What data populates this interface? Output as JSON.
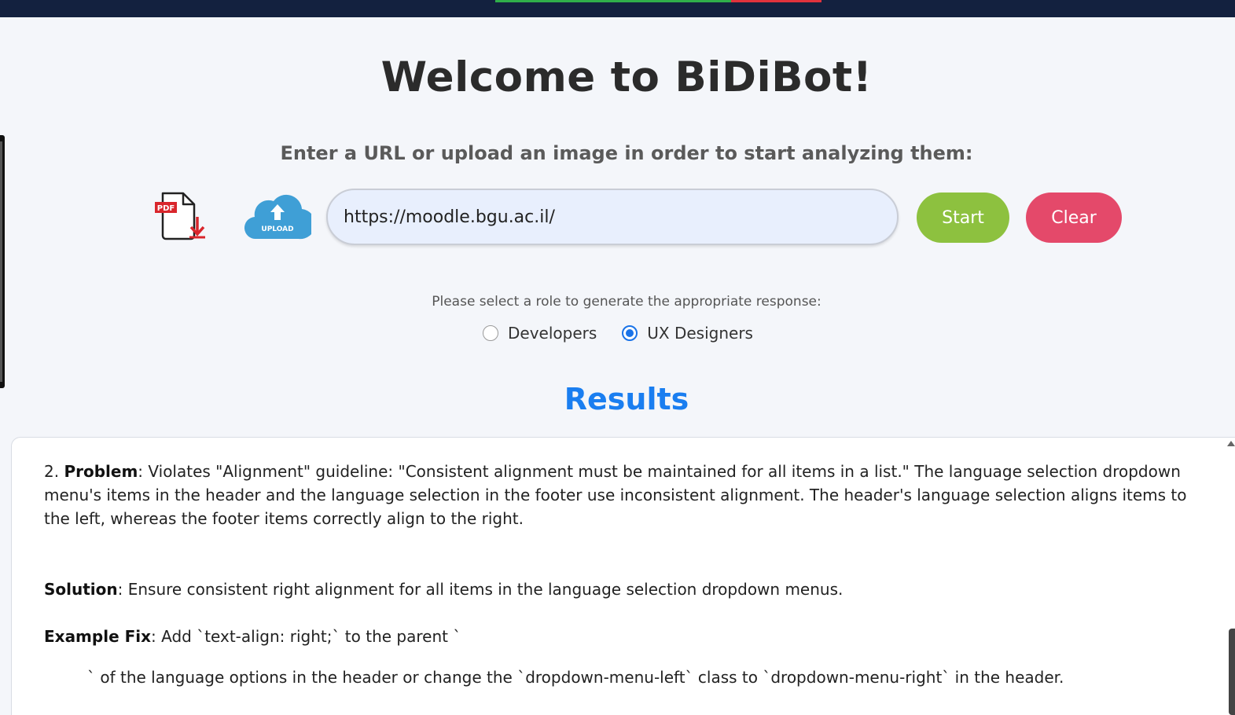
{
  "header": {
    "title": "Welcome to BiDiBot!",
    "subtitle": "Enter a URL or upload an image in order to start analyzing them:"
  },
  "actions": {
    "pdf_icon": "pdf-download-icon",
    "pdf_badge": "PDF",
    "upload_icon": "cloud-upload-icon",
    "upload_label": "UPLOAD",
    "url_value": "https://moodle.bgu.ac.il/",
    "start_label": "Start",
    "clear_label": "Clear",
    "start_color": "#8dc13f",
    "clear_color": "#e4496a"
  },
  "roles": {
    "prompt": "Please select a role to generate the appropriate response:",
    "options": [
      {
        "label": "Developers",
        "selected": false
      },
      {
        "label": "UX Designers",
        "selected": true
      }
    ]
  },
  "results": {
    "heading": "Results",
    "problem_number": "2.",
    "problem_label": "Problem",
    "problem_text": ": Violates \"Alignment\" guideline: \"Consistent alignment must be maintained for all items in a list.\" The language selection dropdown menu's items in the header and the language selection in the footer use inconsistent alignment. The header's language selection aligns items to the left, whereas the footer items correctly align to the right.",
    "solution_label": "Solution",
    "solution_text": ": Ensure consistent right alignment for all items in the language selection dropdown menus.",
    "fix_label": "Example Fix",
    "fix_text": ": Add `text-align: right;` to the parent `",
    "fix_continuation": "` of the language options in the header or change the `dropdown-menu-left` class to `dropdown-menu-right` in the header."
  }
}
